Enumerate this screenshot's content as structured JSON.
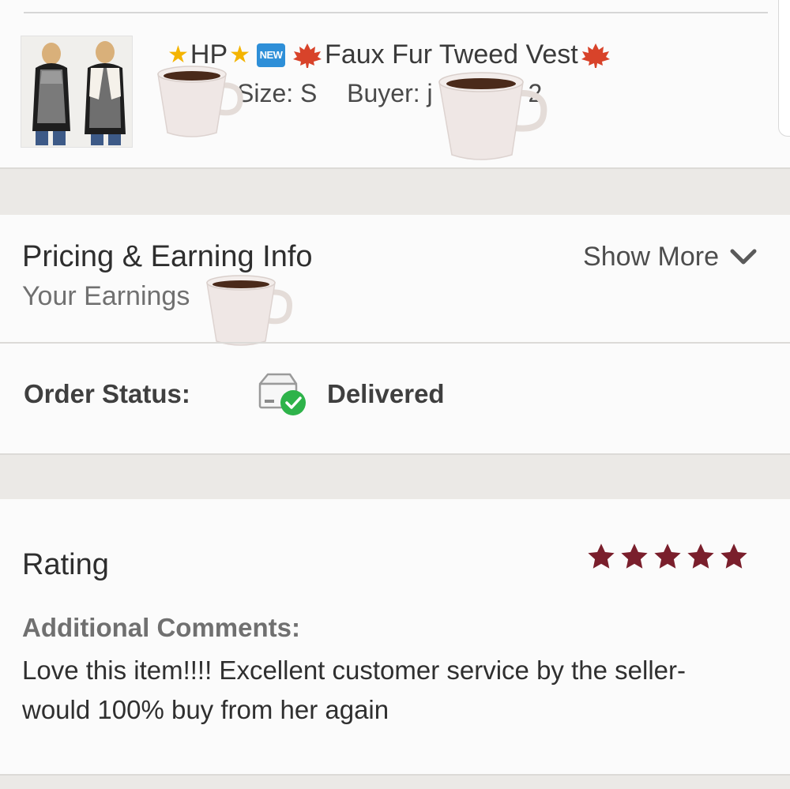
{
  "item": {
    "title_prefix": "HP",
    "new_badge": "NEW",
    "title_name": "Faux Fur Tweed Vest",
    "size_label": "Size: S",
    "buyer_label": "Buyer: j",
    "buyer_tail": "2",
    "image_alt": "vest product photo"
  },
  "pricing": {
    "title": "Pricing & Earning Info",
    "earnings_label": "Your Earnings",
    "show_more_label": "Show More",
    "chevron_icon": "chevron-down-icon"
  },
  "order_status": {
    "label": "Order Status:",
    "value": "Delivered",
    "icon": "delivered-box-icon",
    "check_color": "#2eb34a"
  },
  "rating": {
    "label": "Rating",
    "stars": 5,
    "max_stars": 5,
    "star_color": "#7a1f2c",
    "comments_label": "Additional Comments:",
    "comments": "Love this item!!!! Excellent customer service by the seller- would 100% buy from her again"
  }
}
